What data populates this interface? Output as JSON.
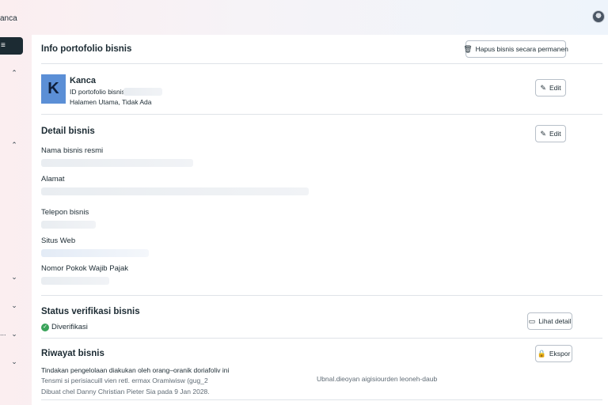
{
  "app": {
    "brand": "anca"
  },
  "sidebar": {
    "active_glyph": "≡",
    "chevrons": [
      {
        "glyph": "⌃",
        "icon": "chevron-up-icon"
      },
      {
        "glyph": "⌃",
        "icon": "chevron-up-icon"
      },
      {
        "glyph": "⌄",
        "icon": "chevron-down-icon"
      },
      {
        "glyph": "⌄",
        "icon": "chevron-down-icon"
      },
      {
        "glyph": "⌄",
        "icon": "chevron-down-icon"
      },
      {
        "glyph": "⌄",
        "icon": "chevron-down-icon"
      }
    ],
    "ellipsis": "..."
  },
  "portfolio": {
    "title": "Info portofolio bisnis",
    "delete_button": "Hapus bisnis secara permanen",
    "logo_letter": "K",
    "name": "Kanca",
    "id_label": "ID portofolio bisnis:",
    "homepage": "Halamen Utama, Tidak Ada",
    "edit_button": "Edit"
  },
  "details": {
    "title": "Detail bisnis",
    "edit_button": "Edit",
    "fields": {
      "legal_name": "Nama bisnis resmi",
      "address": "Alamat",
      "phone": "Telepon bisnis",
      "website": "Situs Web",
      "tax_id": "Nomor Pokok Wajib Pajak"
    }
  },
  "verification": {
    "title": "Status verifikasi bisnis",
    "status": "Diverifikasi",
    "details_button": "Lihat detail"
  },
  "history": {
    "title": "Riwayat bisnis",
    "export_button": "Ekspor",
    "entry_title": "Tindakan pengelolaan diakukan oleh orang–oranik doriafoliv ini",
    "entry_desc": "Tensmi si perisiacuill vien retl. ermax Oramiwisw (gug_2",
    "entry_right": "Ubnal.dieoyan aigisiourden leoneh-daub",
    "entry_meta": "Dibuat chel Danny Christian Pieter Sia pada 9 Jan 2028."
  },
  "colors": {
    "accent_dark": "#1c2b33",
    "logo_bg": "#5b8fd6",
    "verified_green": "#3aa35a"
  }
}
